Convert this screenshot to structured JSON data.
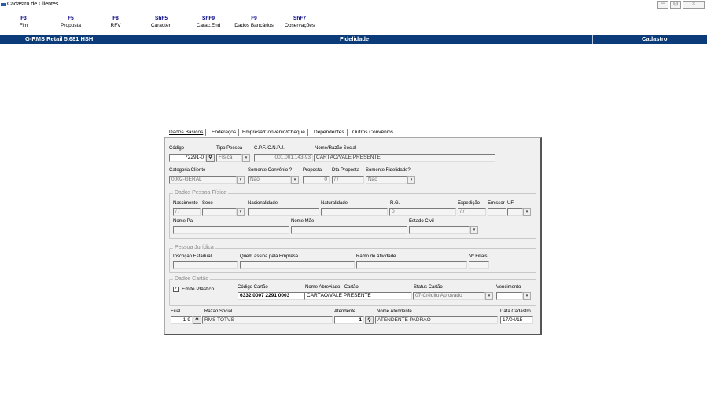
{
  "window": {
    "title": "Cadastro de Clientes",
    "btn_min": "▭",
    "btn_max": "⊡",
    "btn_close": "✕"
  },
  "fkeys": [
    {
      "key": "F3",
      "label": "Fim"
    },
    {
      "key": "F5",
      "label": "Proposta"
    },
    {
      "key": "F8",
      "label": "RFV"
    },
    {
      "key": "ShF5",
      "label": "Caracter."
    },
    {
      "key": "ShF9",
      "label": "Carac.End"
    },
    {
      "key": "F9",
      "label": "Dados Bancários"
    },
    {
      "key": "ShF7",
      "label": "Observações"
    }
  ],
  "status": {
    "app": "G-RMS Retail 5.681 HSH",
    "module": "Fidelidade",
    "mode": "Cadastro"
  },
  "tabs": [
    "Dados Básicos",
    "Endereços",
    "Empresa/Convênio/Cheque",
    "Dependentes",
    "Outros Convênios"
  ],
  "basic": {
    "lbl_codigo": "Código",
    "codigo": "72291-0",
    "lbl_tipo": "Tipo Pessoa",
    "tipo": "Física",
    "lbl_cpf": "C.P.F./C.N.P.J.",
    "cpf": "001.001.143-93",
    "lbl_nome": "Nome/Razão Social",
    "nome": "CARTÃO/VALE PRESENTE",
    "lbl_categoria": "Categoria Cliente",
    "categoria": "0002-GERAL",
    "lbl_somente_conv": "Somente Convênio ?",
    "somente_conv": "Não",
    "lbl_proposta": "Proposta",
    "proposta": "0",
    "lbl_dta_proposta": "Dta Proposta",
    "dta_proposta": "/ /",
    "lbl_somente_fid": "Somente Fidelidade?",
    "somente_fid": "Não"
  },
  "pf": {
    "title": "Dados Pessoa Física",
    "lbl_nasc": "Nascimento",
    "nasc": "/ /",
    "lbl_sexo": "Sexo",
    "lbl_nacionalidade": "Nacionalidade",
    "lbl_naturalidade": "Naturalidade",
    "lbl_rg": "R.G.",
    "rg": "0",
    "lbl_expedicao": "Expedição",
    "expedicao": "/ /",
    "lbl_emissor": "Emissor",
    "lbl_uf": "UF",
    "lbl_pai": "Nome Pai",
    "lbl_mae": "Nome Mãe",
    "lbl_civil": "Estado Civil"
  },
  "pj": {
    "title": "Pessoa Jurídica",
    "lbl_ie": "Inscrição Estadual",
    "lbl_quem": "Quem assina pela Empresa",
    "lbl_ramo": "Ramo de Atividade",
    "lbl_filiais": "Nº Filiais"
  },
  "cartao": {
    "title": "Dados Cartão",
    "emite": "Emite Plástico",
    "emite_checked": "✓",
    "lbl_codigo": "Código Cartão",
    "codigo": "6332 0007 2291 0003",
    "lbl_nome_abrev": "Nome Abreviado - Cartão",
    "nome_abrev": "CARTÃO/VALE PRESENTE",
    "lbl_status": "Status Cartão",
    "status": "07-Crédito Aprovado",
    "lbl_venc": "Vencimento"
  },
  "footer": {
    "lbl_filial": "Filial",
    "filial": "1-9",
    "lbl_razao": "Razão Social",
    "razao": "RMS TOTVS",
    "lbl_atendente": "Atendente",
    "atendente": "1",
    "lbl_nome_atend": "Nome Atendente",
    "nome_atend": "ATENDENTE PADRAO",
    "lbl_data": "Data Cadastro",
    "data": "17/04/15"
  },
  "icons": {
    "binoculars": "binoculars-icon",
    "dropdown": "▾"
  },
  "colors": {
    "statusbar": "#0b3b78",
    "fkey": "#000080"
  }
}
